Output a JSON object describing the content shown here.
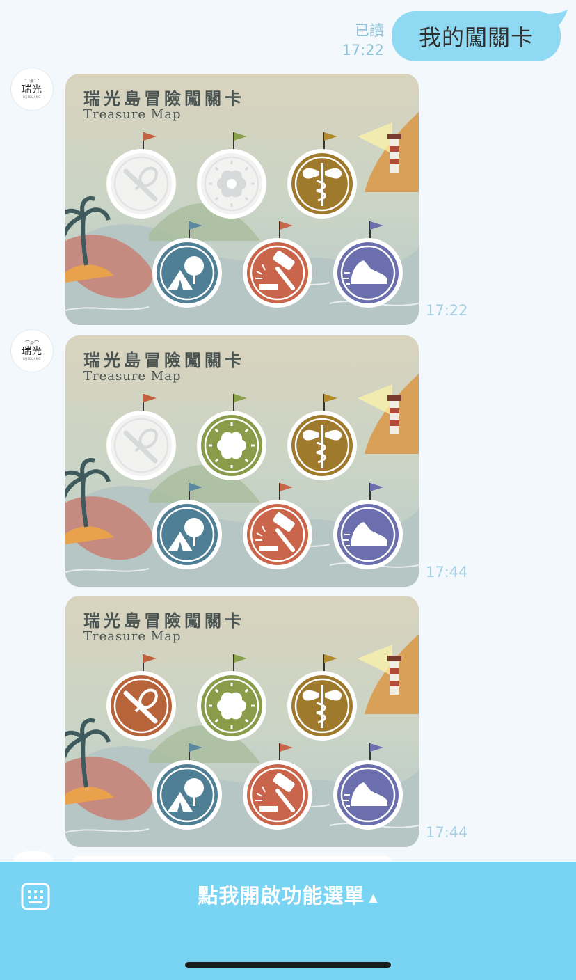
{
  "sent": {
    "read_label": "已讀",
    "time": "17:22",
    "text": "我的闖關卡"
  },
  "avatar": {
    "logo_text": "瑞光",
    "logo_sub": "RUIGUANG"
  },
  "cards": [
    {
      "title": "瑞光島冒險闖關卡",
      "subtitle": "Treasure Map",
      "time": "17:22",
      "badges": [
        {
          "name": "rolling-pin-whisk",
          "completed": false,
          "color": "#b8643a"
        },
        {
          "name": "flower",
          "completed": false,
          "color": "#8a9c4a"
        },
        {
          "name": "caduceus",
          "completed": true,
          "color": "#a07a2c"
        },
        {
          "name": "camping-tent",
          "completed": true,
          "color": "#4f7f95"
        },
        {
          "name": "gavel",
          "completed": true,
          "color": "#c9654a"
        },
        {
          "name": "sneaker",
          "completed": true,
          "color": "#6b6fae"
        }
      ]
    },
    {
      "title": "瑞光島冒險闖關卡",
      "subtitle": "Treasure Map",
      "time": "17:44",
      "badges": [
        {
          "name": "rolling-pin-whisk",
          "completed": false,
          "color": "#b8643a"
        },
        {
          "name": "flower",
          "completed": true,
          "color": "#8a9c4a"
        },
        {
          "name": "caduceus",
          "completed": true,
          "color": "#a07a2c"
        },
        {
          "name": "camping-tent",
          "completed": true,
          "color": "#4f7f95"
        },
        {
          "name": "gavel",
          "completed": true,
          "color": "#c9654a"
        },
        {
          "name": "sneaker",
          "completed": true,
          "color": "#6b6fae"
        }
      ]
    },
    {
      "title": "瑞光島冒險闖關卡",
      "subtitle": "Treasure Map",
      "time": "17:44",
      "badges": [
        {
          "name": "rolling-pin-whisk",
          "completed": true,
          "color": "#b8643a"
        },
        {
          "name": "flower",
          "completed": true,
          "color": "#8a9c4a"
        },
        {
          "name": "caduceus",
          "completed": true,
          "color": "#a07a2c"
        },
        {
          "name": "camping-tent",
          "completed": true,
          "color": "#4f7f95"
        },
        {
          "name": "gavel",
          "completed": true,
          "color": "#c9654a"
        },
        {
          "name": "sneaker",
          "completed": true,
          "color": "#6b6fae"
        }
      ]
    }
  ],
  "menu": {
    "label": "點我開啟功能選單",
    "caret": "▲",
    "keyboard_icon": "keyboard-icon"
  },
  "colors": {
    "accent": "#79d4f4",
    "sent_bubble": "#8fd9f3",
    "timestamp": "#a5cfe0"
  }
}
